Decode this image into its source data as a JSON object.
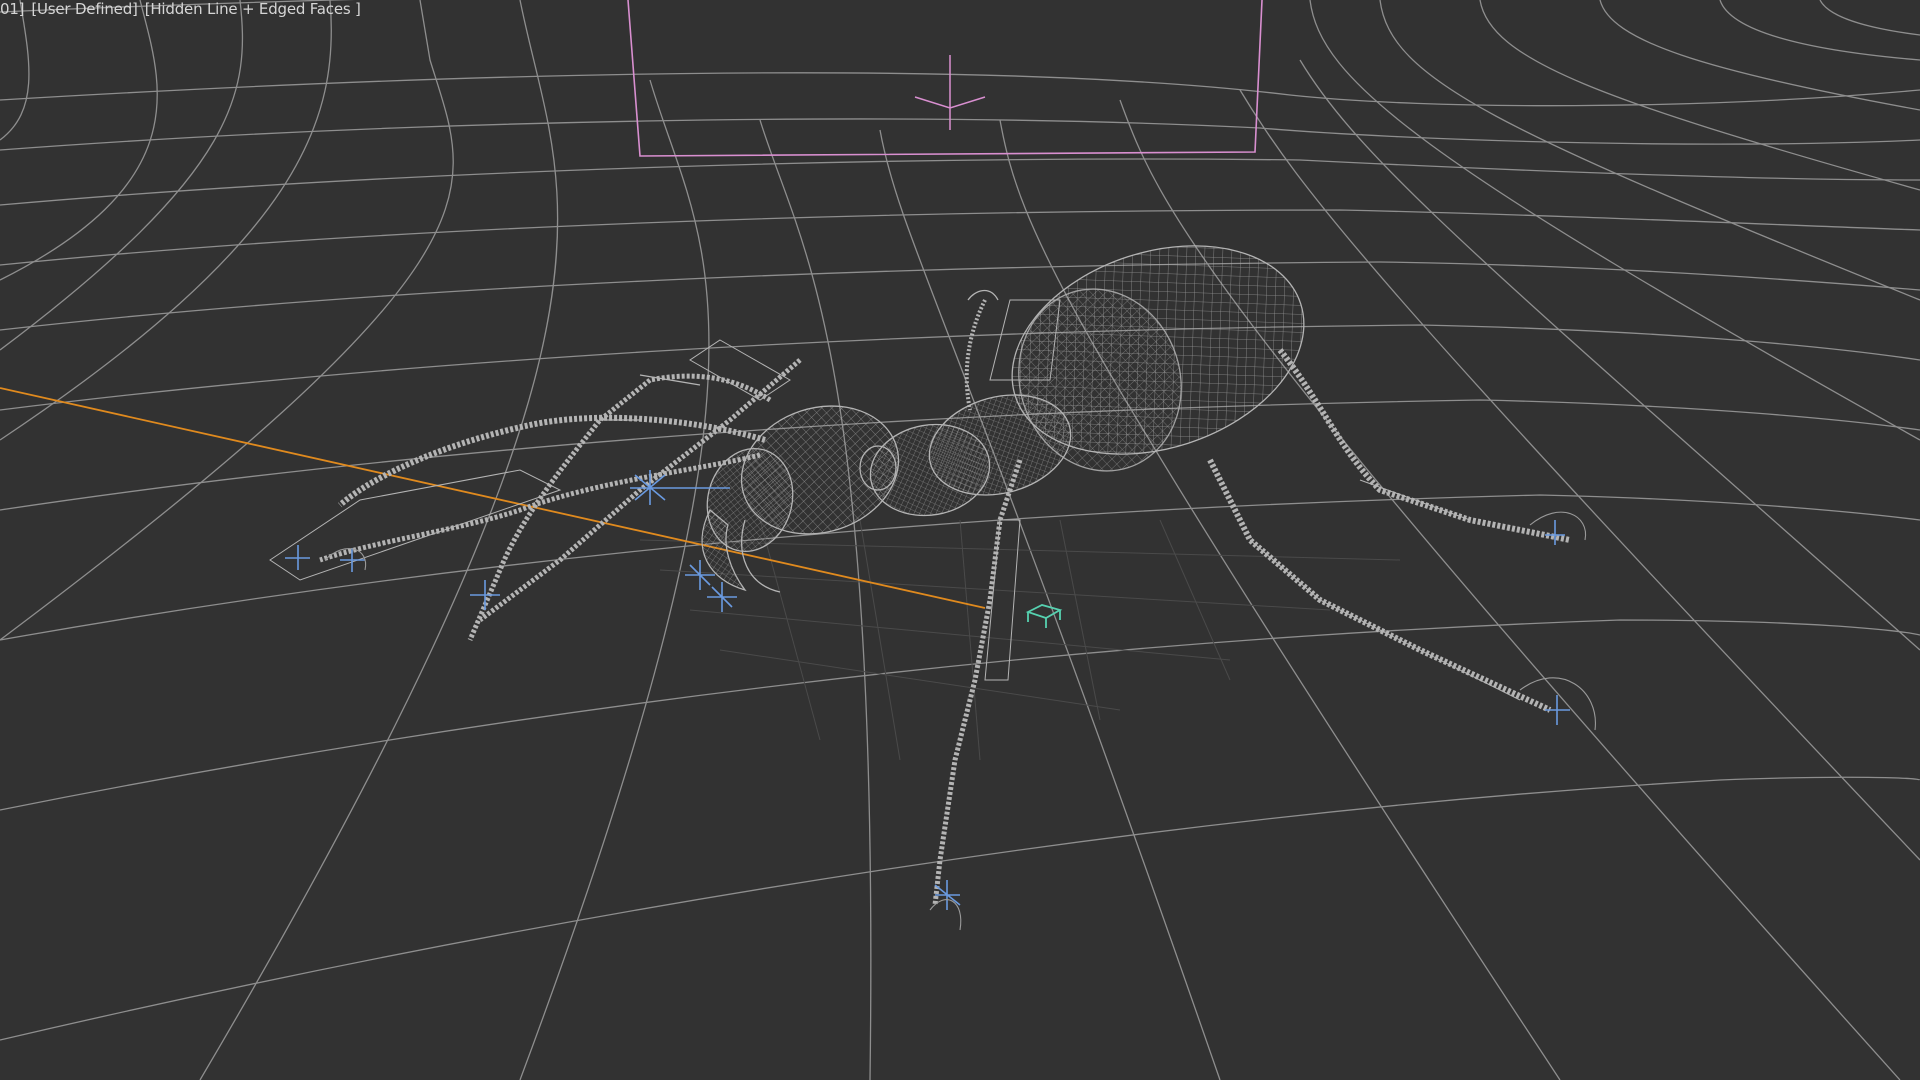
{
  "viewport": {
    "label_prefix": "01]",
    "view_menu": "[User Defined]",
    "shading_menu": "[Hidden Line + Edged Faces ]"
  },
  "colors": {
    "background": "#323232",
    "grid": "#8a8a8a",
    "wireframe": "#b4b4b4",
    "camera_frame": "#d98fd0",
    "target_line": "#e08a1e",
    "helper": "#6a9ae0",
    "object_icon": "#56d1b0"
  },
  "scene": {
    "object": "ant-wireframe-model",
    "background_geometry": "curved-backdrop-grid"
  }
}
